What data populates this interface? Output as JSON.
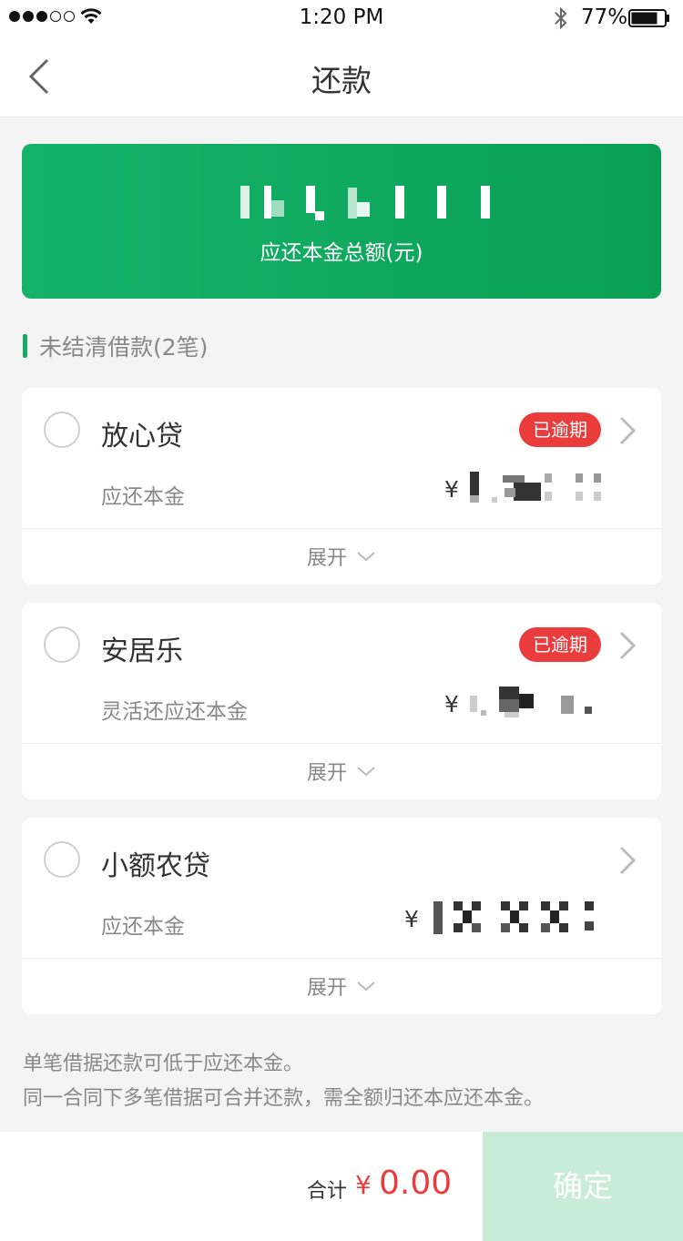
{
  "status_bar": {
    "time": "1:20 PM",
    "battery": "77%"
  },
  "nav": {
    "title": "还款"
  },
  "banner": {
    "amount_label": "应还本金总额(元)"
  },
  "section": {
    "title": "未结清借款(2笔)"
  },
  "loans": [
    {
      "name": "放心贷",
      "badge": "已逾期",
      "label": "应还本金",
      "currency": "¥",
      "expand": "展开"
    },
    {
      "name": "安居乐",
      "badge": "已逾期",
      "label": "灵活还应还本金",
      "currency": "¥",
      "expand": "展开"
    },
    {
      "name": "小额农贷",
      "badge": "",
      "label": "应还本金",
      "currency": "¥",
      "expand": "展开"
    }
  ],
  "notes": [
    "单笔借据还款可低于应还本金。",
    "同一合同下多笔借据可合并还款，需全额归还本应还本金。"
  ],
  "footer": {
    "total_label": "合计",
    "total_currency": "¥",
    "total_value": "0.00",
    "confirm_label": "确定"
  },
  "colors": {
    "brand_green": "#0ea35e",
    "overdue_red": "#ea3c3c",
    "confirm_disabled": "#c9ecd9"
  },
  "icons": [
    "wifi-icon",
    "bluetooth-icon",
    "battery-icon",
    "back-arrow-icon",
    "radio-unchecked-icon",
    "chevron-right-icon",
    "chevron-down-icon"
  ]
}
